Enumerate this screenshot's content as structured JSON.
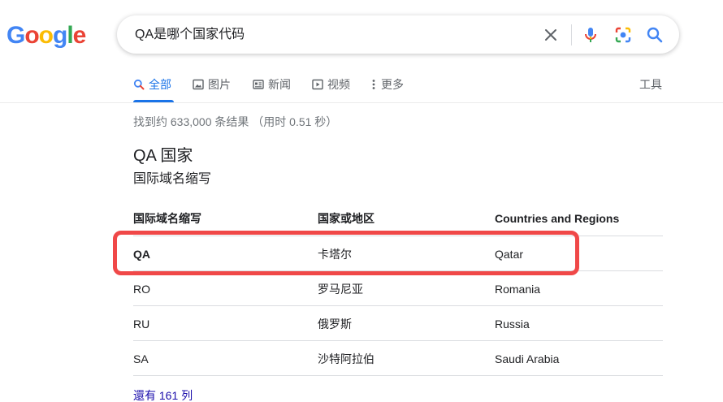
{
  "logo": {
    "letters": [
      "G",
      "o",
      "o",
      "g",
      "l",
      "e"
    ],
    "colors": [
      "#4285f4",
      "#ea4335",
      "#fbbc05",
      "#4285f4",
      "#34a853",
      "#ea4335"
    ]
  },
  "search": {
    "query": "QA是哪个国家代码"
  },
  "tabs": [
    {
      "label": "全部",
      "icon": "search-icon",
      "active": true
    },
    {
      "label": "图片",
      "icon": "image-icon"
    },
    {
      "label": "新闻",
      "icon": "news-icon"
    },
    {
      "label": "视频",
      "icon": "video-icon"
    },
    {
      "label": "更多",
      "icon": "more-vert-icon"
    }
  ],
  "tools_label": "工具",
  "result_stats": "找到约 633,000 条结果 （用时 0.51 秒）",
  "answer": {
    "title": "QA 国家",
    "subtitle": "国际域名缩写"
  },
  "table": {
    "headers": [
      "国际域名缩写",
      "国家或地区",
      "Countries and Regions"
    ],
    "rows": [
      [
        "QA",
        "卡塔尔",
        "Qatar"
      ],
      [
        "RO",
        "罗马尼亚",
        "Romania"
      ],
      [
        "RU",
        "俄罗斯",
        "Russia"
      ],
      [
        "SA",
        "沙特阿拉伯",
        "Saudi Arabia"
      ]
    ]
  },
  "more_rows_link": "還有 161 列",
  "colors": {
    "accent": "#1a73e8",
    "highlight": "#f04848",
    "link": "#1a0dab"
  }
}
